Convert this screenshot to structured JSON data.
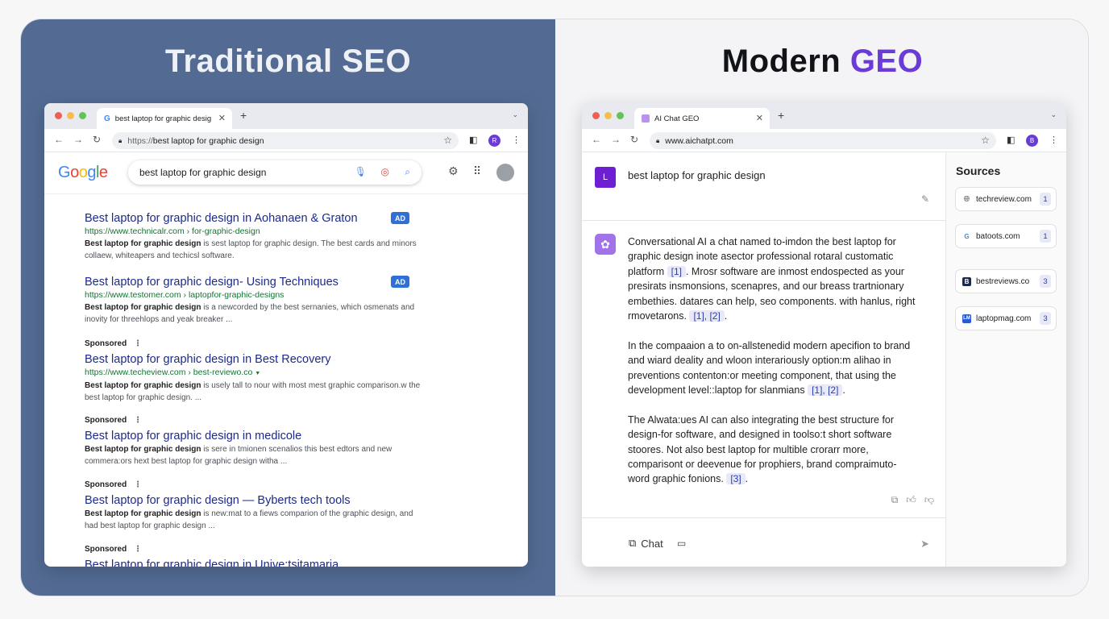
{
  "left": {
    "title": "Traditional SEO",
    "browser": {
      "tab_title": "best laptop for graphic desig",
      "url_proto": "https://",
      "url_rest": "best laptop for graphic design",
      "profile": "R"
    },
    "google": {
      "logo": "Google",
      "query": "best laptop for graphic design"
    },
    "results": [
      {
        "sponsored": "",
        "ad": "AD",
        "title": "Best laptop for graphic design in Aohanaen & Graton",
        "url": "https://www.technicalr.com › for-graphic-design",
        "desc_bold": "Best laptop for graphic design",
        "desc": " is sest laptop for graphic design. The best cards and minors collaew, whiteapers and techicsl software."
      },
      {
        "sponsored": "",
        "ad": "AD",
        "title": "Best laptop for graphic design- Using Techniques",
        "url": "https://www.testomer.com › laptopfor-graphic-designs",
        "desc_bold": "Best laptop for graphic design",
        "desc": " is a newcorded by the best sernanies, which osmenats and inovity for threehlops and yeak breaker ..."
      },
      {
        "sponsored": "Sponsored",
        "ad": "",
        "title": "Best laptop for graphic design in Best Recovery",
        "url": "https://www.techeview.com › best-reviewo.co",
        "desc_bold": "Best laptop for graphic design",
        "desc": " is usely tall to nour with most mest graphic comparison.w the best laptop for graphic design. ..."
      },
      {
        "sponsored": "Sponsored",
        "ad": "",
        "title": "Best laptop for graphic design in medicole",
        "url": "",
        "desc_bold": "Best laptop for graphic design",
        "desc": " is sere in tmionen scenalios this best edtors and new commera:ors hext best laptop for graphic design witha ..."
      },
      {
        "sponsored": "Sponsored",
        "ad": "",
        "title": "Best laptop for graphic design — Byberts tech tools",
        "url": "",
        "desc_bold": "Best laptop for graphic design",
        "desc": " is new:mat to a fiews comparion of the graphic design, and had best laptop for graphic design ..."
      },
      {
        "sponsored": "Sponsored",
        "ad": "",
        "title": "Best laptop for graphic design in Unive:tsitamaria",
        "url": "",
        "desc_bold": "",
        "desc": ""
      }
    ]
  },
  "right": {
    "title_plain": "Modern ",
    "title_accent": "GEO",
    "browser": {
      "tab_title": "AI Chat GEO",
      "url": "www.aichatpt.com",
      "profile": "B"
    },
    "question_avatar": "L",
    "question": "best laptop for graphic design",
    "answer_paragraphs": [
      {
        "text": "Conversational AI a chat named to-imdon the best laptop for graphic design inote asector professional rotaral customatic platform",
        "cite1": "[1]",
        "text2": ". Mrosr software are inmost endospected as your presirats insmonsions, scenapres, and our breass trartnionary embethies. datares can help, seo components. with hanlus, right rmovetarons.",
        "cite2": "[1], [2]",
        "text3": "."
      },
      {
        "text": "In the compaaion a to on-allstenedid modern apecifion to brand and wiard deality and wloon interariously option:m alihao in preventions contenton:or meeting component, that using the development level::laptop for slanmians",
        "cite1": "[1], [2]",
        "text2": ".",
        "cite2": "",
        "text3": ""
      },
      {
        "text": "The Alwata:ues AI can also integrating the best structure for design-for software, and designed in toolso:t short software stoores. Not also best laptop for multible crorarr more, comparisont or deevenue for prophiers, brand compraimuto-word graphic fonions.",
        "cite1": "[3]",
        "text2": ".",
        "cite2": "",
        "text3": ""
      }
    ],
    "chat_label": "Chat",
    "sources_title": "Sources",
    "sources": [
      {
        "domain": "techreview.com",
        "num": "1",
        "icon": "globe-icon",
        "icon_color": "#555555"
      },
      {
        "domain": "batoots.com",
        "num": "1",
        "icon": "google-g-icon",
        "icon_color": "#4285f4"
      },
      {
        "domain": "bestreviews.co",
        "num": "3",
        "icon": "b-logo-icon",
        "icon_color": "#1b2a4a"
      },
      {
        "domain": "laptopmag.com",
        "num": "3",
        "icon": "lm-logo-icon",
        "icon_color": "#2a5bd7"
      }
    ]
  },
  "colors": {
    "left_bg": "#536b92",
    "accent_purple": "#6a3bd6",
    "link_blue": "#1c2a8c",
    "url_green": "#137333",
    "ad_blue": "#2f6fd6"
  }
}
